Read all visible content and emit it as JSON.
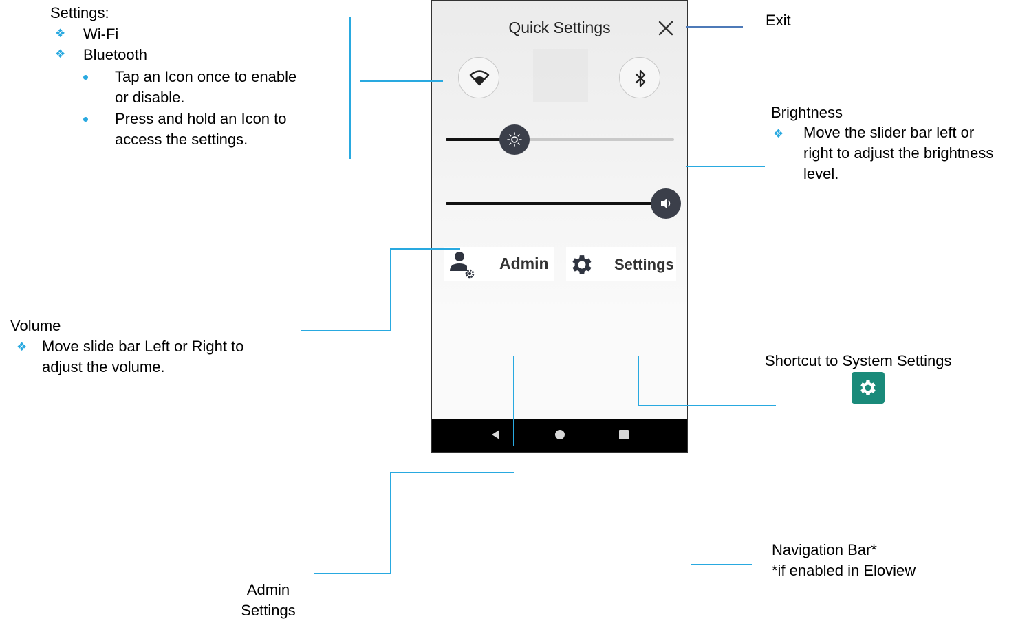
{
  "settings_note": {
    "heading": "Settings:",
    "items": [
      "Wi-Fi",
      "Bluetooth"
    ],
    "tips_line1a": "Tap an Icon once to enable",
    "tips_line1b": "or disable.",
    "tips_line2a": "Press and hold an Icon to",
    "tips_line2b": "access the settings."
  },
  "volume_note": {
    "heading": "Volume",
    "line_a": "Move slide bar Left or Right to",
    "line_b": "adjust the volume."
  },
  "admin_note": {
    "line_a": "Admin",
    "line_b": "Settings"
  },
  "exit_note": {
    "label": "Exit"
  },
  "brightness_note": {
    "heading": "Brightness",
    "line_a": "Move the slider bar left or",
    "line_b": "right to adjust the brightness",
    "line_c": "level."
  },
  "shortcut_note": {
    "label": "Shortcut to System Settings"
  },
  "navbar_note": {
    "line_a": "Navigation Bar*",
    "line_b": "*if enabled in Eloview"
  },
  "phone": {
    "title": "Quick Settings",
    "brightness_level": 0.3,
    "volume_level": 1.0,
    "admin_label": "Admin",
    "settings_label": "Settings"
  },
  "colors": {
    "accent": "#29a9e0",
    "thumb": "#3b3f4a",
    "shortcut": "#1a8a7a"
  },
  "icons": [
    "close-icon",
    "wifi-icon",
    "bluetooth-icon",
    "brightness-icon",
    "volume-icon",
    "admin-icon",
    "gear-icon",
    "back-icon",
    "home-icon",
    "recents-icon"
  ]
}
